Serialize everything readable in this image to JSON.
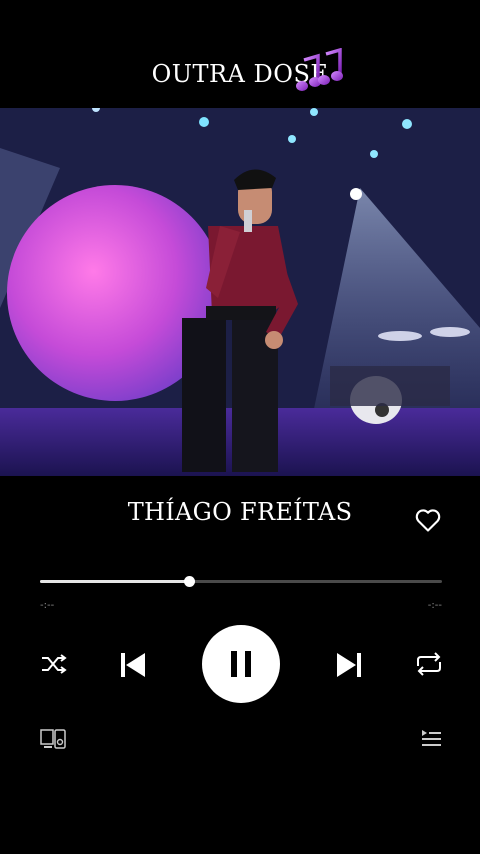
{
  "header": {
    "song_title": "OUTRA DOSE",
    "notes_icon": "musical-notes-icon"
  },
  "video": {
    "description_icon": "concert-video-frame"
  },
  "track": {
    "artist": "THÍAGO FREÍTAS",
    "liked_icon": "heart-outline-icon"
  },
  "progress": {
    "fraction": 0.37,
    "elapsed": "-:--",
    "remaining": "-:--"
  },
  "controls": {
    "shuffle_icon": "shuffle-icon",
    "prev_icon": "skip-previous-icon",
    "play_state": "playing",
    "next_icon": "skip-next-icon",
    "repeat_icon": "repeat-icon"
  },
  "footer": {
    "devices_icon": "connect-devices-icon",
    "queue_icon": "queue-icon"
  },
  "colors": {
    "background": "#000000",
    "accent_purple": "#a23bd9",
    "track_fill": "#e6e6e6",
    "track_bg": "#4a4a4a"
  }
}
